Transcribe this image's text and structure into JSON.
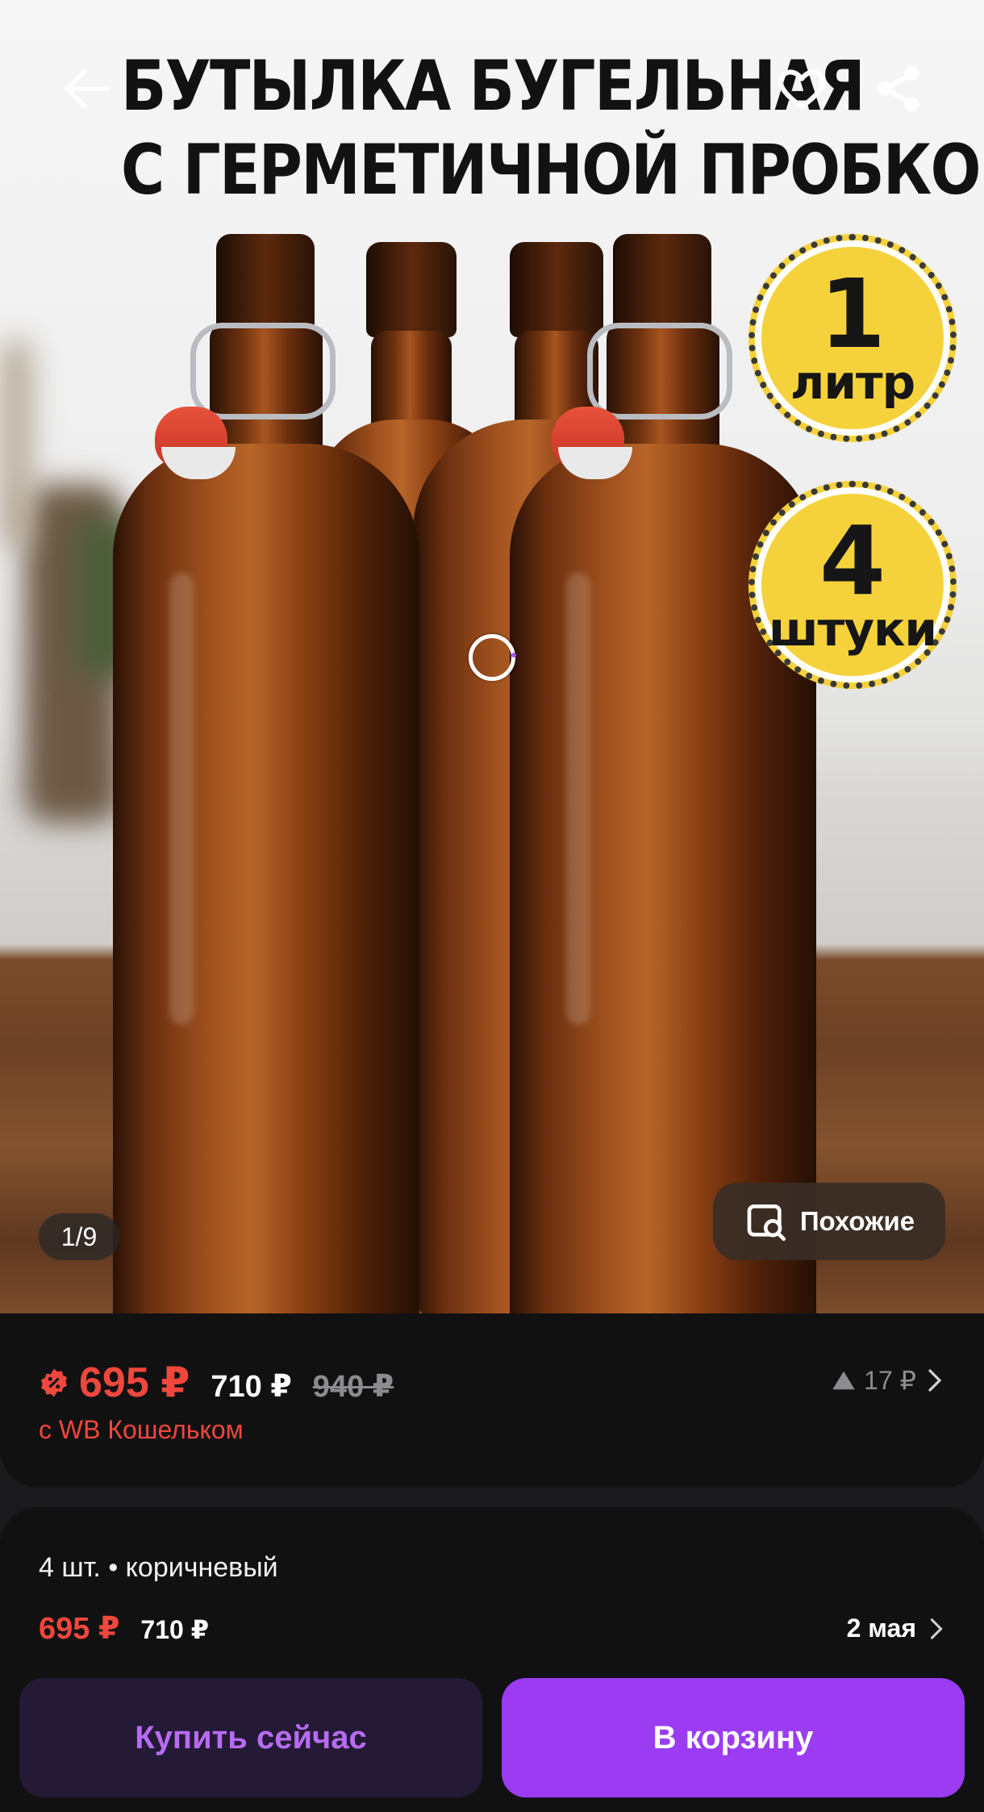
{
  "product_image": {
    "title_line1": "БУТЫЛКА БУГЕЛЬНАЯ",
    "title_line2": "С ГЕРМЕТИЧНОЙ ПРОБКОЙ",
    "badge_volume": {
      "num": "1",
      "unit": "литр"
    },
    "badge_count": {
      "num": "4",
      "unit": "штуки"
    },
    "page_counter": "1/9",
    "similar_label": "Похожие"
  },
  "header": {
    "back_icon": "arrow-left-icon",
    "favorite_icon": "heart-icon",
    "share_icon": "share-icon"
  },
  "price": {
    "wallet_price": "695 ₽",
    "price": "710 ₽",
    "old_price": "940 ₽",
    "wallet_note": "с WB Кошельком",
    "change": "17 ₽"
  },
  "variant": {
    "description": "4 шт. • коричневый",
    "wallet_price": "695 ₽",
    "price": "710 ₽",
    "delivery_date": "2 мая"
  },
  "actions": {
    "buy_now": "Купить сейчас",
    "add_to_cart": "В корзину"
  },
  "colors": {
    "accent_purple": "#9b3cf3",
    "price_red": "#f0473d",
    "card_bg": "#111112"
  }
}
